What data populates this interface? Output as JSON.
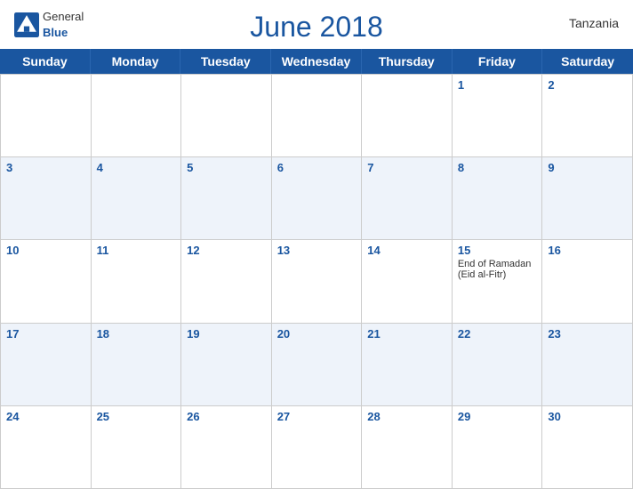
{
  "header": {
    "title": "June 2018",
    "country": "Tanzania",
    "logo": {
      "general": "General",
      "blue": "Blue"
    }
  },
  "days": [
    "Sunday",
    "Monday",
    "Tuesday",
    "Wednesday",
    "Thursday",
    "Friday",
    "Saturday"
  ],
  "weeks": [
    [
      {
        "day": "",
        "empty": true
      },
      {
        "day": "",
        "empty": true
      },
      {
        "day": "",
        "empty": true
      },
      {
        "day": "",
        "empty": true
      },
      {
        "day": "",
        "empty": true
      },
      {
        "day": "1",
        "empty": false
      },
      {
        "day": "2",
        "empty": false
      }
    ],
    [
      {
        "day": "3",
        "empty": false
      },
      {
        "day": "4",
        "empty": false
      },
      {
        "day": "5",
        "empty": false
      },
      {
        "day": "6",
        "empty": false
      },
      {
        "day": "7",
        "empty": false
      },
      {
        "day": "8",
        "empty": false
      },
      {
        "day": "9",
        "empty": false
      }
    ],
    [
      {
        "day": "10",
        "empty": false
      },
      {
        "day": "11",
        "empty": false
      },
      {
        "day": "12",
        "empty": false
      },
      {
        "day": "13",
        "empty": false
      },
      {
        "day": "14",
        "empty": false
      },
      {
        "day": "15",
        "empty": false,
        "event": "End of Ramadan (Eid al-Fitr)"
      },
      {
        "day": "16",
        "empty": false
      }
    ],
    [
      {
        "day": "17",
        "empty": false
      },
      {
        "day": "18",
        "empty": false
      },
      {
        "day": "19",
        "empty": false
      },
      {
        "day": "20",
        "empty": false
      },
      {
        "day": "21",
        "empty": false
      },
      {
        "day": "22",
        "empty": false
      },
      {
        "day": "23",
        "empty": false
      }
    ],
    [
      {
        "day": "24",
        "empty": false
      },
      {
        "day": "25",
        "empty": false
      },
      {
        "day": "26",
        "empty": false
      },
      {
        "day": "27",
        "empty": false
      },
      {
        "day": "28",
        "empty": false
      },
      {
        "day": "29",
        "empty": false
      },
      {
        "day": "30",
        "empty": false
      }
    ]
  ],
  "colors": {
    "primary": "#1a56a0",
    "header_bg": "#1a56a0",
    "row_alt": "#eef3fa",
    "text": "#333",
    "border": "#ccc"
  }
}
